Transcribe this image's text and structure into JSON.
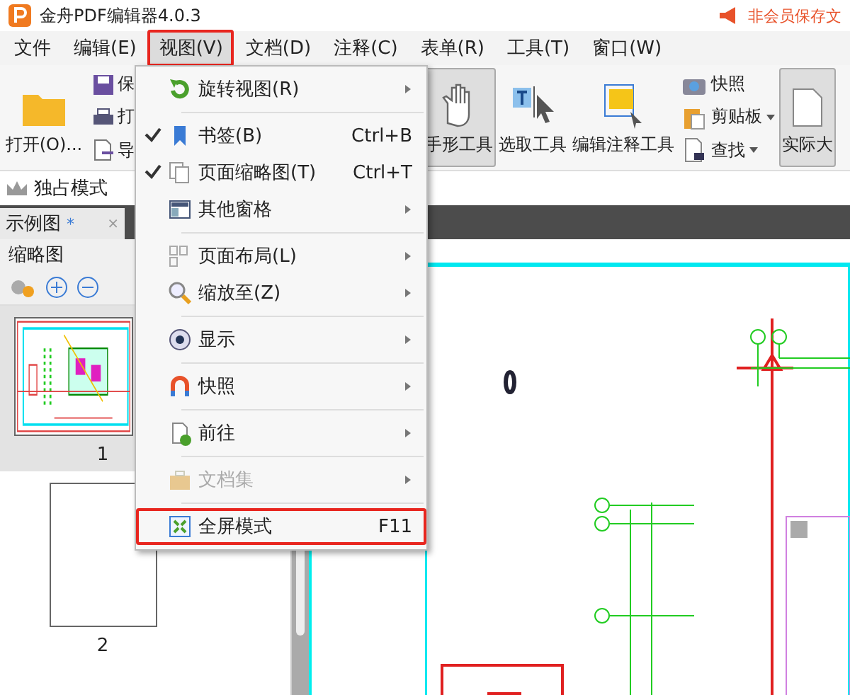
{
  "window": {
    "title": "金舟PDF编辑器4.0.3",
    "notice": "非会员保存文"
  },
  "menu_bar": [
    {
      "label": "文件",
      "selected": false
    },
    {
      "label": "编辑(E)",
      "selected": false
    },
    {
      "label": "视图(V)",
      "selected": true
    },
    {
      "label": "文档(D)",
      "selected": false
    },
    {
      "label": "注释(C)",
      "selected": false
    },
    {
      "label": "表单(R)",
      "selected": false
    },
    {
      "label": "工具(T)",
      "selected": false
    },
    {
      "label": "窗口(W)",
      "selected": false
    }
  ],
  "ribbon": {
    "open": {
      "label": "打开(O)..."
    },
    "file_column": [
      {
        "label": "保",
        "kind": "save"
      },
      {
        "label": "打",
        "kind": "print"
      },
      {
        "label": "导",
        "kind": "export"
      }
    ],
    "tools": [
      {
        "label": "手形工具",
        "kind": "hand",
        "pressed": true
      },
      {
        "label": "选取工具",
        "kind": "select",
        "pressed": false
      },
      {
        "label": "编辑注释工具",
        "kind": "annotate",
        "pressed": false
      }
    ],
    "small_column": [
      {
        "label": "快照",
        "kind": "camera",
        "dropdown": false
      },
      {
        "label": "剪贴板",
        "kind": "clipboard",
        "dropdown": true
      },
      {
        "label": "查找",
        "kind": "find",
        "dropdown": true
      }
    ],
    "actual_size": {
      "label": "实际大",
      "pressed": true
    }
  },
  "mode_bar": {
    "label": "独占模式"
  },
  "doc_tabs": [
    {
      "label": "示例图",
      "modified": "*",
      "close": "×"
    }
  ],
  "view_menu": {
    "groups": [
      {
        "items": [
          {
            "label": "旋转视图(R)",
            "kind": "rotate",
            "submenu": true,
            "disabled": false,
            "checked": false,
            "highlighted": false
          }
        ]
      },
      {
        "items": [
          {
            "label": "书签(B)",
            "kind": "bookmark",
            "shortcut": "Ctrl+B",
            "submenu": false,
            "disabled": false,
            "checked": true,
            "highlighted": false
          },
          {
            "label": "页面缩略图(T)",
            "kind": "pages",
            "shortcut": "Ctrl+T",
            "submenu": false,
            "disabled": false,
            "checked": true,
            "highlighted": false
          },
          {
            "label": "其他窗格",
            "kind": "panes",
            "submenu": true,
            "disabled": false,
            "checked": false,
            "highlighted": false
          }
        ]
      },
      {
        "items": [
          {
            "label": "页面布局(L)",
            "kind": "layout",
            "submenu": true,
            "disabled": false,
            "checked": false,
            "highlighted": false
          },
          {
            "label": "缩放至(Z)",
            "kind": "zoom",
            "submenu": true,
            "disabled": false,
            "checked": false,
            "highlighted": false
          }
        ]
      },
      {
        "items": [
          {
            "label": "显示",
            "kind": "eye",
            "submenu": true,
            "disabled": false,
            "checked": false,
            "highlighted": false
          }
        ]
      },
      {
        "items": [
          {
            "label": "快照",
            "kind": "magnet",
            "submenu": true,
            "disabled": false,
            "checked": false,
            "highlighted": false
          }
        ]
      },
      {
        "items": [
          {
            "label": "前往",
            "kind": "goto",
            "submenu": true,
            "disabled": false,
            "checked": false,
            "highlighted": false
          }
        ]
      },
      {
        "items": [
          {
            "label": "文档集",
            "kind": "briefcase",
            "submenu": true,
            "disabled": true,
            "checked": false,
            "highlighted": false
          }
        ]
      },
      {
        "items": [
          {
            "label": "全屏模式",
            "kind": "fullscreen",
            "shortcut": "F11",
            "submenu": false,
            "disabled": false,
            "checked": false,
            "highlighted": true
          }
        ]
      }
    ]
  },
  "thumbnail_panel": {
    "title": "缩略图",
    "pages": [
      {
        "label": "1",
        "selected": true,
        "kind": "plan"
      },
      {
        "label": "2",
        "selected": false,
        "kind": "blank"
      }
    ]
  }
}
